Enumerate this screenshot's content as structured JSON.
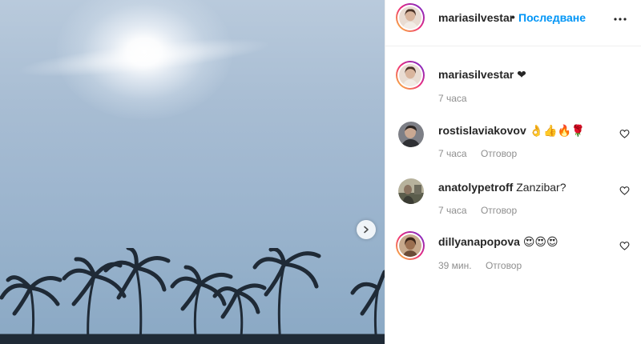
{
  "post": {
    "author": "mariasilvestar",
    "separator": "•",
    "follow_label": "Последване"
  },
  "comments": [
    {
      "username": "mariasilvestar",
      "text": "❤",
      "time": "7 часа",
      "reply_label": ""
    },
    {
      "username": "rostislaviakovov",
      "text": "👌👍🔥🌹",
      "time": "7 часа",
      "reply_label": "Отговор"
    },
    {
      "username": "anatolypetroff",
      "text": "Zanzibar?",
      "time": "7 часа",
      "reply_label": "Отговор"
    },
    {
      "username": "dillyanapopova",
      "text": "😍😍😍",
      "time": "39 мин.",
      "reply_label": "Отговор"
    }
  ],
  "icons": {
    "next": "chevron-right-icon",
    "more": "more-options-icon",
    "like": "heart-icon"
  },
  "colors": {
    "accent": "#0095f6",
    "muted": "#8e8e8e",
    "text": "#262626"
  }
}
